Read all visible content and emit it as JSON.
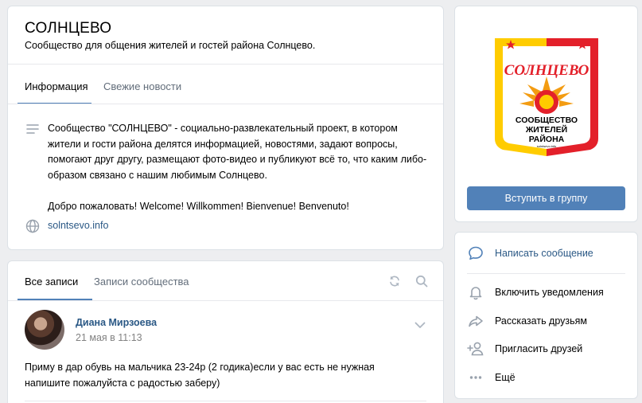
{
  "group": {
    "title": "СОЛНЦЕВО",
    "status": "Сообщество для общения жителей и гостей района Солнцево."
  },
  "info_tabs": [
    {
      "label": "Информация",
      "active": true
    },
    {
      "label": "Свежие новости",
      "active": false
    }
  ],
  "description": {
    "p1": "Сообщество \"СОЛНЦЕВО\" - социально-развлекательный проект, в котором жители и гости района делятся информацией, новостями, задают вопросы, помогают друг другу, размещают фото-видео и публикуют всё то, что каким либо-образом связано с нашим любимым Солнцево.",
    "p2": "Добро пожаловать! Welcome! Willkommen! Bienvenue! Benvenuto!"
  },
  "website": "solntsevo.info",
  "feed_tabs": [
    {
      "label": "Все записи",
      "active": true
    },
    {
      "label": "Записи сообщества",
      "active": false
    }
  ],
  "post": {
    "author": "Диана Мирзоева",
    "date": "21 мая в 11:13",
    "text": "Приму в дар обувь на мальчика 23-24р (2 годика)если у вас есть не нужная напишите пожалуйста с радостью заберу)"
  },
  "logo": {
    "title": "СОЛНЦЕВО",
    "line1": "СООБЩЕСТВО",
    "line2": "ЖИТЕЛЕЙ",
    "line3": "РАЙОНА",
    "site": "solntsevo.info"
  },
  "join_button": "Вступить в группу",
  "actions": [
    {
      "label": "Написать сообщение",
      "icon": "message-icon"
    },
    {
      "label": "Включить уведомления",
      "icon": "bell-icon"
    },
    {
      "label": "Рассказать друзьям",
      "icon": "share-icon"
    },
    {
      "label": "Пригласить друзей",
      "icon": "add-friend-icon"
    },
    {
      "label": "Ещё",
      "icon": "more-icon"
    }
  ],
  "colors": {
    "accent": "#5181b8",
    "link": "#2a5885",
    "background": "#edeef0",
    "logo_red": "#e3202a",
    "logo_yellow": "#ffcc00"
  }
}
